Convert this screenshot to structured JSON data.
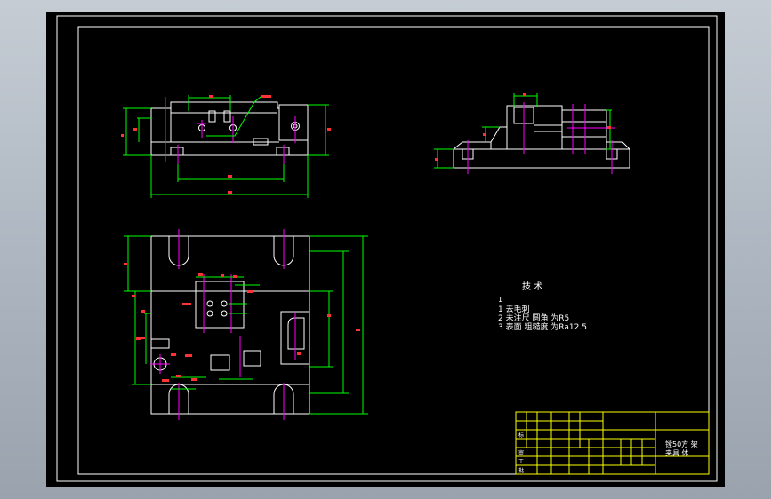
{
  "colors": {
    "background": "#000000",
    "frame": "#ffffff",
    "part": "#ffffff",
    "dimension": "#00ff00",
    "centerline": "#ff00ff",
    "leader": "#ff3333",
    "titleblock": "#ffff00",
    "note": "#ffffff"
  },
  "notes": {
    "heading": "技 术",
    "lines": [
      "1",
      "1  去毛刺",
      "2  未注尺 圆角 为R5",
      "3  表面 粗糙度 为Ra12.5"
    ]
  },
  "title_block": {
    "title_line1": "镗50方 架",
    "title_line2": "夹具 体",
    "cell_labels": [
      "标",
      "审",
      "工",
      "批"
    ]
  }
}
